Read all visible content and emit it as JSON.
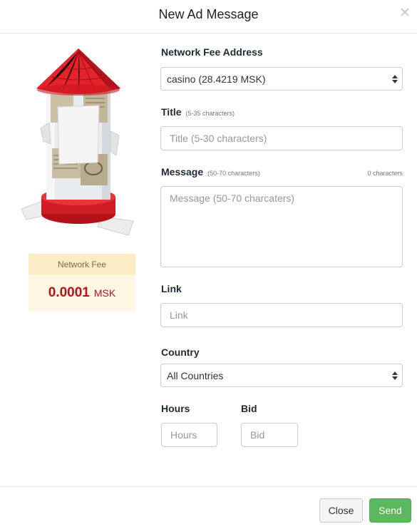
{
  "modal": {
    "title": "New Ad Message"
  },
  "fee": {
    "label": "Network Fee",
    "amount": "0.0001",
    "unit": "MSK"
  },
  "form": {
    "address": {
      "label": "Network Fee Address",
      "selected": "casino (28.4219 MSK)"
    },
    "title": {
      "label": "Title",
      "hint": "(5-35 characters)",
      "placeholder": "Title (5-30 characters)"
    },
    "message": {
      "label": "Message",
      "hint": "(50-70 characters)",
      "counter": "0 characters",
      "placeholder": "Message (50-70 charcaters)"
    },
    "link": {
      "label": "Link",
      "placeholder": "Link"
    },
    "country": {
      "label": "Country",
      "selected": "All Countries"
    },
    "hours": {
      "label": "Hours",
      "placeholder": "Hours"
    },
    "bid": {
      "label": "Bid",
      "placeholder": "Bid"
    }
  },
  "footer": {
    "close_label": "Close",
    "send_label": "Send"
  },
  "colors": {
    "accent_green": "#5cb85c",
    "fee_red": "#b5141b",
    "fee_bg": "#fdf6e3"
  }
}
